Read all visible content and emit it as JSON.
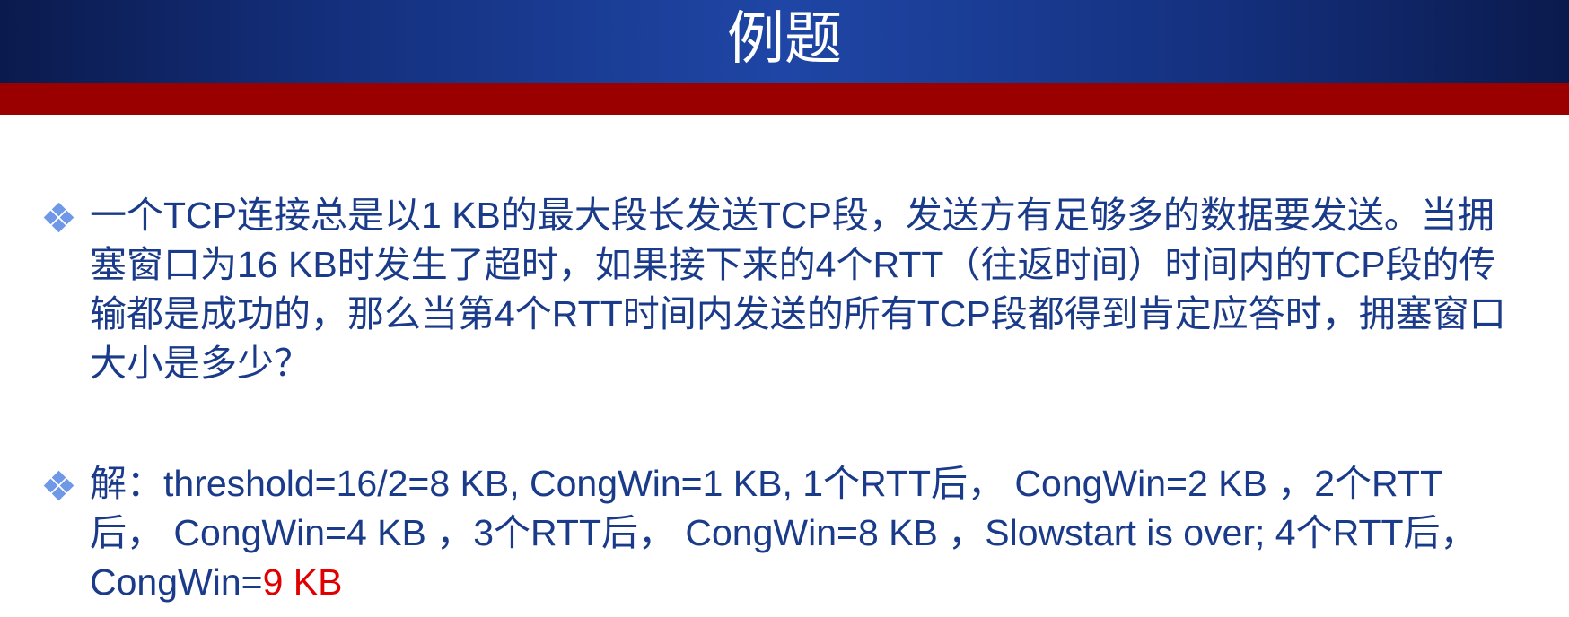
{
  "slide": {
    "title": "例题"
  },
  "bullets": [
    {
      "icon": "diamond-bullet-icon",
      "text": "一个TCP连接总是以1 KB的最大段长发送TCP段，发送方有足够多的数据要发送。当拥塞窗口为16 KB时发生了超时，如果接下来的4个RTT（往返时间）时间内的TCP段的传输都是成功的，那么当第4个RTT时间内发送的所有TCP段都得到肯定应答时，拥塞窗口大小是多少？"
    },
    {
      "icon": "diamond-bullet-icon",
      "text": "解：threshold=16/2=8 KB, CongWin=1 KB, 1个RTT后， CongWin=2 KB ，2个RTT后， CongWin=4 KB ，3个RTT后， CongWin=8 KB ，Slowstart is over; 4个RTT后， CongWin=",
      "answer": "9 KB"
    }
  ],
  "colors": {
    "title_bar": "#14307e",
    "accent_bar": "#9b0000",
    "body_text": "#1a3a8a",
    "answer_text": "#e00000",
    "bullet_icon": "#6f98e6"
  }
}
